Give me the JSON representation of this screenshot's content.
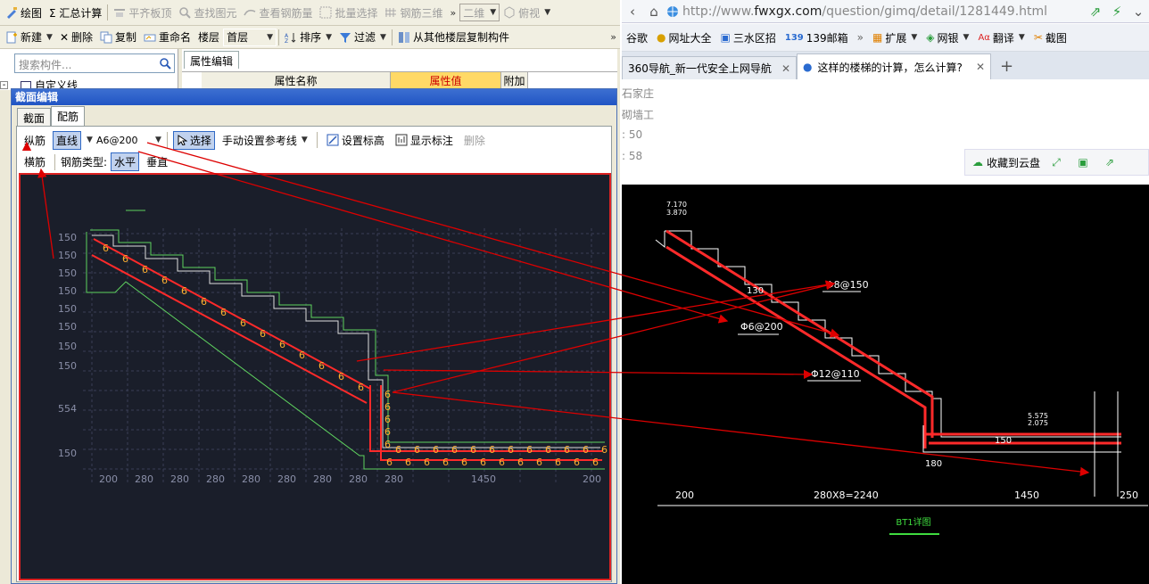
{
  "left_app": {
    "toolbar1": [
      {
        "label": "绘图",
        "disabled": false
      },
      {
        "label": "Σ 汇总计算",
        "disabled": false
      },
      {
        "label": "平齐板顶",
        "disabled": true
      },
      {
        "label": "查找图元",
        "disabled": true
      },
      {
        "label": "查看钢筋量",
        "disabled": true
      },
      {
        "label": "批量选择",
        "disabled": true
      },
      {
        "label": "钢筋三维",
        "disabled": true
      }
    ],
    "toolbar1_view": "二维",
    "toolbar1_angle": "俯视",
    "toolbar2": {
      "new": "新建",
      "delete": "删除",
      "copy": "复制",
      "rename": "重命名",
      "floor_label": "楼层",
      "floor_value": "首层",
      "sort": "排序",
      "filter": "过滤",
      "copy_from_floor": "从其他楼层复制构件"
    },
    "search_placeholder": "搜索构件...",
    "tree_item": "自定义线",
    "prop_tab": "属性编辑",
    "prop_headers": {
      "name": "属性名称",
      "value": "属性值",
      "extra": "附加"
    },
    "dialog": {
      "title": "截面编辑",
      "tabs": [
        "截面",
        "配筋"
      ],
      "long_bar": "纵筋",
      "straight": "直线",
      "bar_spec": "A6@200",
      "select": "选择",
      "manual_ref": "手动设置参考线",
      "set_elev": "设置标高",
      "show_label": "显示标注",
      "delete": "删除",
      "cross_bar": "横筋",
      "bar_type_label": "钢筋类型:",
      "horizontal": "水平",
      "vertical": "垂直",
      "dims_left": [
        "150",
        "150",
        "150",
        "150",
        "150",
        "150",
        "150",
        "150",
        "554",
        "150"
      ],
      "dims_bottom": [
        "200",
        "280",
        "280",
        "280",
        "280",
        "280",
        "280",
        "280",
        "280",
        "1450",
        "200"
      ],
      "bar_mark": "6"
    }
  },
  "browser": {
    "url_prefix": "http://www.",
    "url_domain": "fwxgx.com",
    "url_path": "/question/gimq/detail/1281449.html",
    "bookmarks": [
      "谷歌",
      "网址大全",
      "三水区招",
      "139邮箱",
      "扩展",
      "网银",
      "翻译",
      "截图"
    ],
    "tabs": [
      {
        "title": "360导航_新一代安全上网导航",
        "active": false
      },
      {
        "title": "这样的楼梯的计算，怎么计算?",
        "active": true
      }
    ],
    "page_fragments": [
      "石家庄",
      "砌墙工",
      ": 50",
      ": 58"
    ],
    "cloud_save": "收藏到云盘",
    "drawing": {
      "elev_top": [
        "7.170",
        "3.870"
      ],
      "bar_top": "Φ8@150",
      "bar_mid": "Φ6@200",
      "bar_bot": "Φ12@110",
      "thickness": "130",
      "elev_right": [
        "5.575",
        "2.075"
      ],
      "dim_150": "150",
      "dim_180": "180",
      "dims_bottom": [
        "200",
        "280X8=2240",
        "1450",
        "250"
      ],
      "title": "BT1详图"
    }
  },
  "colors": {
    "accent": "#316ac5",
    "cad_bg": "#1a1e2a",
    "rebar": "#ff2a2a",
    "dim_line": "#ffffff",
    "annotation_arrow": "#dd0000"
  }
}
